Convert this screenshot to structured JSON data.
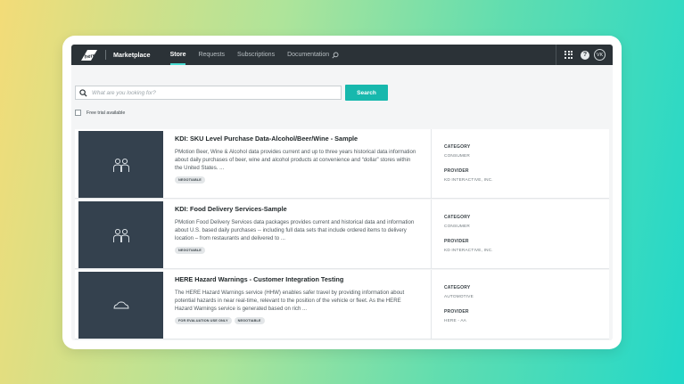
{
  "header": {
    "app_title": "Marketplace",
    "nav": [
      {
        "label": "Store",
        "active": true
      },
      {
        "label": "Requests",
        "active": false
      },
      {
        "label": "Subscriptions",
        "active": false
      },
      {
        "label": "Documentation",
        "active": false
      }
    ],
    "help_label": "?",
    "avatar_initials": "VK",
    "icons": [
      "here-logo-icon",
      "search-icon",
      "apps-grid-icon",
      "help-icon",
      "avatar"
    ]
  },
  "search": {
    "placeholder": "What are you looking for?",
    "value": "",
    "button_label": "Search"
  },
  "filters": {
    "free_trial_label": "Free trial available",
    "free_trial_checked": false
  },
  "listings": [
    {
      "title": "KDI: SKU Level Purchase Data-Alcohol/Beer/Wine - Sample",
      "description": "PMotion Beer, Wine & Alcohol data provides current and up to three years historical data information about daily purchases of beer, wine and alcohol products at convenience and “dollar” stores within the United States.  ...",
      "tags": [
        "NEGOTIABLE"
      ],
      "category_label": "CATEGORY",
      "category": "CONSUMER",
      "provider_label": "PROVIDER",
      "provider": "KD INTERACTIVE, INC.",
      "thumb_icon": "people-icon"
    },
    {
      "title": "KDI: Food Delivery Services-Sample",
      "description": "PMotion Food Delivery Services data packages provides current and historical data and information about U.S. based daily purchases -- including full data sets that include ordered items to delivery location – from restaurants and delivered to ...",
      "tags": [
        "NEGOTIABLE"
      ],
      "category_label": "CATEGORY",
      "category": "CONSUMER",
      "provider_label": "PROVIDER",
      "provider": "KD INTERACTIVE, INC.",
      "thumb_icon": "people-icon"
    },
    {
      "title": "HERE Hazard Warnings - Customer Integration Testing",
      "description": "The HERE Hazard Warnings service (HHW) enables safer travel by providing information about potential hazards in near real-time, relevant to the position of the vehicle or fleet.  As the HERE Hazard Warnings service is generated based on rich ...",
      "tags": [
        "FOR EVALUATION USE ONLY",
        "NEGOTIABLE"
      ],
      "category_label": "CATEGORY",
      "category": "AUTOMOTIVE",
      "provider_label": "PROVIDER",
      "provider": "HERE - AA",
      "thumb_icon": "car-icon"
    }
  ],
  "colors": {
    "topbar": "#2b3237",
    "accent": "#17b8ad",
    "nav_underline": "#48dad0",
    "thumb_bg": "#34414e"
  }
}
